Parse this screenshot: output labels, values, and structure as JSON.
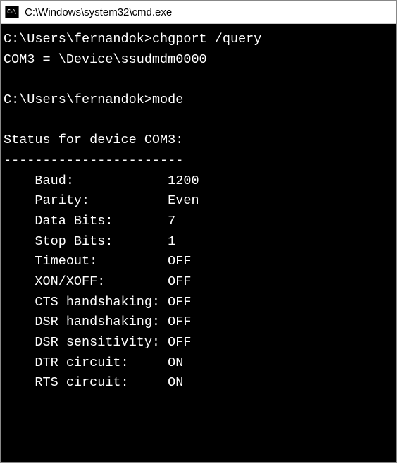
{
  "window": {
    "title": "C:\\Windows\\system32\\cmd.exe",
    "icon_label": "C:\\"
  },
  "terminal": {
    "line1_prompt": "C:\\Users\\fernandok>",
    "line1_cmd": "chgport /query",
    "line2": "COM3 = \\Device\\ssudmdm0000",
    "line3_prompt": "C:\\Users\\fernandok>",
    "line3_cmd": "mode",
    "status_header": "Status for device COM3:",
    "divider": "-----------------------",
    "rows": [
      {
        "label": "Baud:",
        "value": "1200"
      },
      {
        "label": "Parity:",
        "value": "Even"
      },
      {
        "label": "Data Bits:",
        "value": "7"
      },
      {
        "label": "Stop Bits:",
        "value": "1"
      },
      {
        "label": "Timeout:",
        "value": "OFF"
      },
      {
        "label": "XON/XOFF:",
        "value": "OFF"
      },
      {
        "label": "CTS handshaking:",
        "value": "OFF"
      },
      {
        "label": "DSR handshaking:",
        "value": "OFF"
      },
      {
        "label": "DSR sensitivity:",
        "value": "OFF"
      },
      {
        "label": "DTR circuit:",
        "value": "ON"
      },
      {
        "label": "RTS circuit:",
        "value": "ON"
      }
    ]
  }
}
